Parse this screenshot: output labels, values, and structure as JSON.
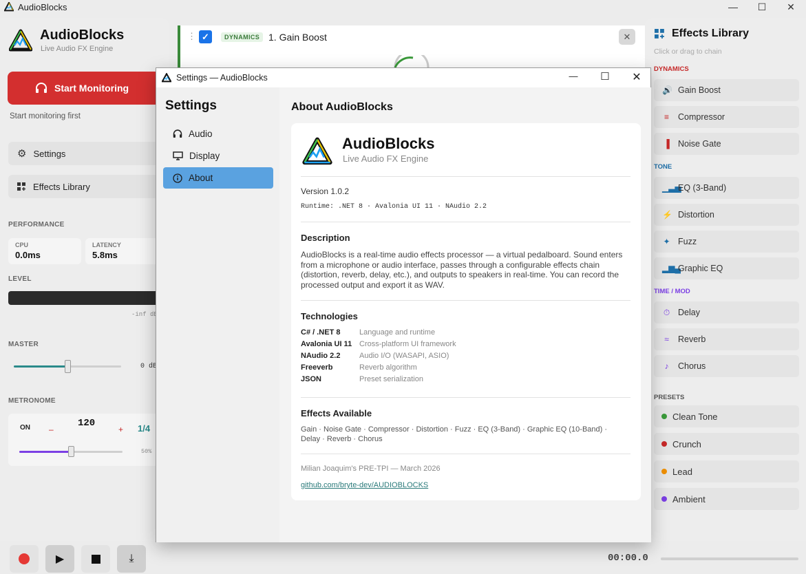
{
  "window": {
    "title": "AudioBlocks"
  },
  "app": {
    "name": "AudioBlocks",
    "subtitle": "Live Audio FX Engine"
  },
  "left": {
    "start_label": "Start Monitoring",
    "start_note": "Start monitoring first",
    "nav": [
      {
        "label": "Settings",
        "icon": "gear-icon"
      },
      {
        "label": "Effects Library",
        "icon": "grid-plus-icon"
      }
    ],
    "performance_label": "PERFORMANCE",
    "cpu": {
      "label": "CPU",
      "value": "0.0ms"
    },
    "latency": {
      "label": "LATENCY",
      "value": "5.8ms"
    },
    "level_label": "LEVEL",
    "level_db": "-inf dB",
    "master_label": "MASTER",
    "master_value": 0.5,
    "master_db": "0 dB",
    "metronome_label": "METRONOME",
    "metro_on": "ON",
    "metro_minus": "–",
    "metro_bpm": "120",
    "metro_plus": "+",
    "metro_sig": "1/4",
    "metro_vol": "50%",
    "metro_vol_value": 0.5
  },
  "chain": {
    "badge": "DYNAMICS",
    "title": "1. Gain Boost",
    "checked": true
  },
  "library": {
    "title": "Effects Library",
    "hint": "Click or drag to chain",
    "categories": [
      {
        "name": "DYNAMICS",
        "color": "#c62828",
        "items": [
          {
            "label": "Gain Boost",
            "icon": "volume-icon",
            "color": "#c62828"
          },
          {
            "label": "Compressor",
            "icon": "compress-icon",
            "color": "#c62828"
          },
          {
            "label": "Noise Gate",
            "icon": "gate-icon",
            "color": "#c62828"
          }
        ]
      },
      {
        "name": "TONE",
        "color": "#1e6fa8",
        "items": [
          {
            "label": "EQ (3-Band)",
            "icon": "bars-icon",
            "color": "#1e6fa8"
          },
          {
            "label": "Distortion",
            "icon": "bolt-icon",
            "color": "#1e6fa8"
          },
          {
            "label": "Fuzz",
            "icon": "fuzz-icon",
            "color": "#1e6fa8"
          },
          {
            "label": "Graphic EQ",
            "icon": "bar-chart-icon",
            "color": "#1e6fa8"
          }
        ]
      },
      {
        "name": "TIME / MOD",
        "color": "#7b3fe4",
        "items": [
          {
            "label": "Delay",
            "icon": "timer-icon",
            "color": "#7b3fe4"
          },
          {
            "label": "Reverb",
            "icon": "waves-icon",
            "color": "#7b3fe4"
          },
          {
            "label": "Chorus",
            "icon": "note-icon",
            "color": "#7b3fe4"
          }
        ]
      }
    ],
    "presets_label": "PRESETS",
    "presets": [
      {
        "label": "Clean Tone",
        "color": "#3a9a3a"
      },
      {
        "label": "Crunch",
        "color": "#c62828"
      },
      {
        "label": "Lead",
        "color": "#ef8f00"
      },
      {
        "label": "Ambient",
        "color": "#7b3fe4"
      }
    ]
  },
  "transport": {
    "timecode": "00:00.0"
  },
  "dialog": {
    "title": "Settings — AudioBlocks",
    "heading": "Settings",
    "nav": [
      {
        "label": "Audio",
        "icon": "headphones-icon"
      },
      {
        "label": "Display",
        "icon": "monitor-icon"
      },
      {
        "label": "About",
        "icon": "info-icon",
        "active": true
      }
    ],
    "about": {
      "heading": "About AudioBlocks",
      "name": "AudioBlocks",
      "subtitle": "Live Audio FX Engine",
      "version": "Version 1.0.2",
      "runtime": "Runtime: .NET 8 · Avalonia UI 11 · NAudio 2.2",
      "description_h": "Description",
      "description": "AudioBlocks is a real-time audio effects processor — a virtual pedalboard. Sound enters from a microphone or audio interface, passes through a configurable effects chain (distortion, reverb, delay, etc.), and outputs to speakers in real-time. You can record the processed output and export it as WAV.",
      "tech_h": "Technologies",
      "tech": [
        {
          "k": "C# / .NET 8",
          "v": "Language and runtime"
        },
        {
          "k": "Avalonia UI 11",
          "v": "Cross-platform UI framework"
        },
        {
          "k": "NAudio 2.2",
          "v": "Audio I/O (WASAPI, ASIO)"
        },
        {
          "k": "Freeverb",
          "v": "Reverb algorithm"
        },
        {
          "k": "JSON",
          "v": "Preset serialization"
        }
      ],
      "effects_h": "Effects Available",
      "effects": "Gain · Noise Gate · Compressor · Distortion · Fuzz · EQ (3-Band) · Graphic EQ (10-Band) · Delay · Reverb · Chorus",
      "credit": "Milian Joaquim's PRE-TPI — March 2026",
      "link": "github.com/bryte-dev/AUDIOBLOCKS"
    }
  }
}
